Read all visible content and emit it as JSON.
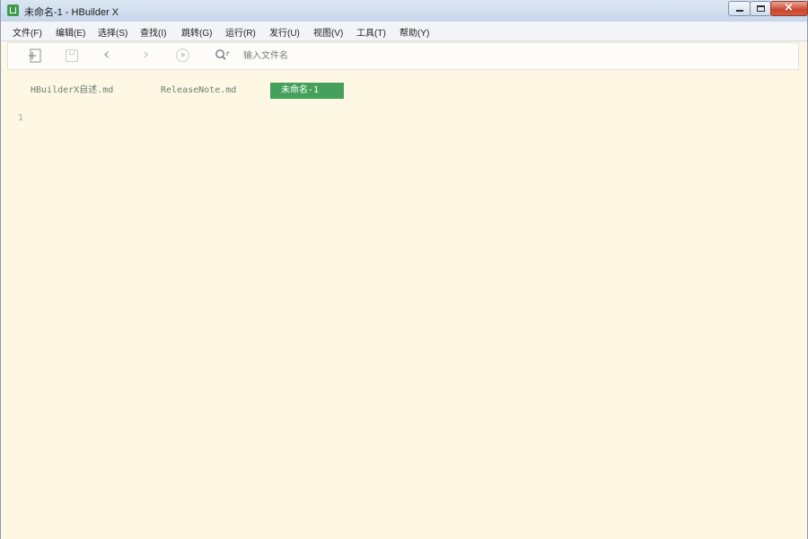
{
  "window": {
    "title": "未命名-1 - HBuilder X"
  },
  "menu": [
    "文件(F)",
    "编辑(E)",
    "选择(S)",
    "查找(I)",
    "跳转(G)",
    "运行(R)",
    "发行(U)",
    "视图(V)",
    "工具(T)",
    "帮助(Y)"
  ],
  "toolbar": {
    "icons": [
      "new-file-icon",
      "save-icon",
      "back-icon",
      "forward-icon",
      "run-icon",
      "search-icon"
    ],
    "back_glyph": "‹",
    "forward_glyph": "›",
    "search_placeholder": "输入文件名"
  },
  "tabs": [
    {
      "label": "HBuilderX自述.md",
      "active": false
    },
    {
      "label": "ReleaseNote.md",
      "active": false
    },
    {
      "label": "未命名-1",
      "active": true
    }
  ],
  "editor": {
    "line_numbers": [
      "1"
    ]
  },
  "colors": {
    "editor_background": "#fdf7e4",
    "active_tab": "#44a05a",
    "app_icon": "#3c9a4e"
  }
}
